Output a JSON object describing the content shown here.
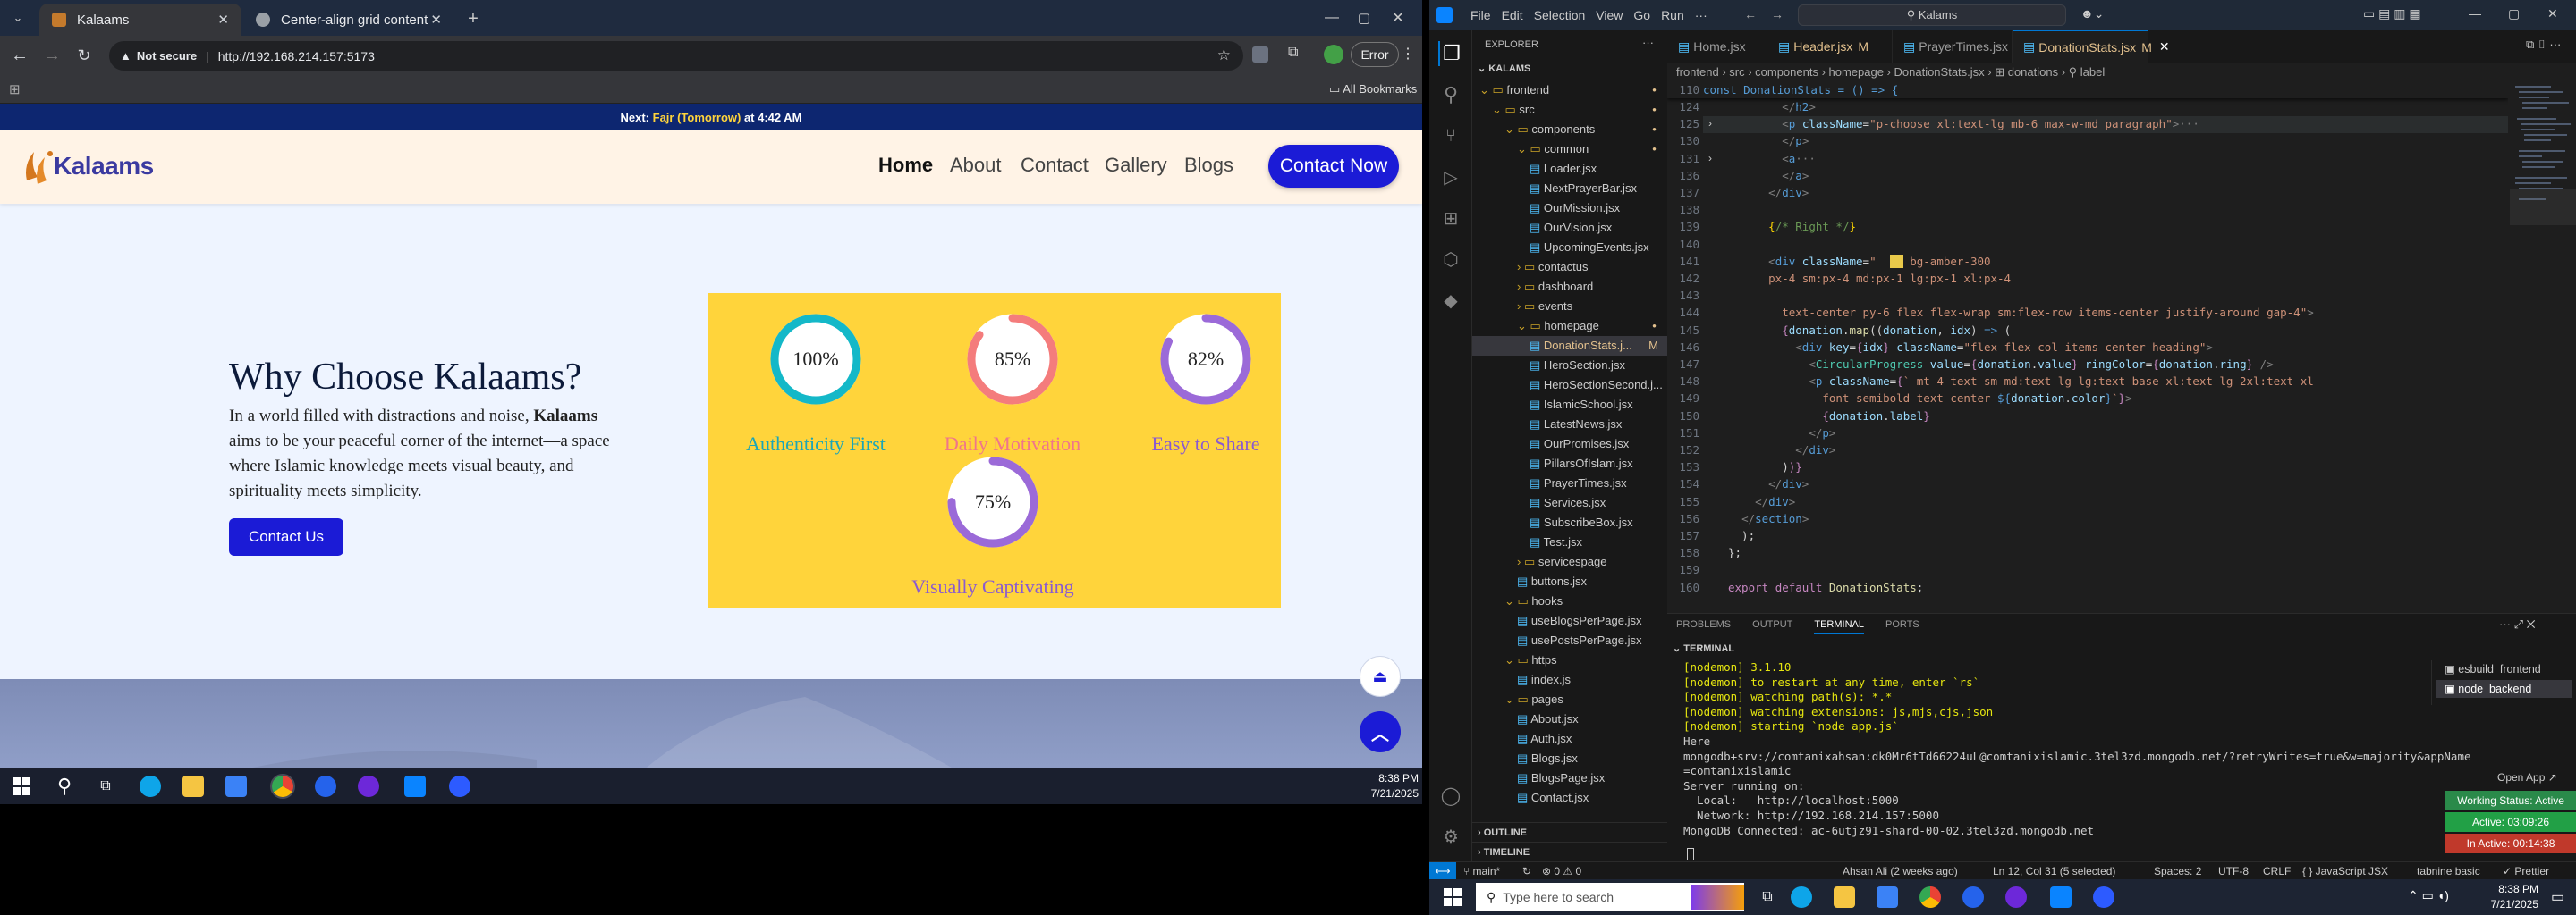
{
  "browser": {
    "tabs": [
      {
        "title": "Kalaams",
        "active": true
      },
      {
        "title": "Center-align grid content",
        "active": false
      }
    ],
    "new_tab": "+",
    "not_secure": "Not secure",
    "url": "http://192.168.214.157:5173",
    "error_label": "Error",
    "bookmarks_label": "All Bookmarks"
  },
  "site": {
    "prayer_prefix": "Next: ",
    "prayer_name": "Fajr (Tomorrow)",
    "prayer_suffix": " at 4:42 AM",
    "logo_text": "Kalaams",
    "nav": [
      "Home",
      "About",
      "Contact",
      "Gallery",
      "Blogs"
    ],
    "contact_now": "Contact Now",
    "why_title": "Why Choose Kalaams?",
    "why_para_1": "In a world filled with distractions and noise, ",
    "why_brand": "Kalaams",
    "why_para_2": " aims to be your peaceful corner of the internet—a space where Islamic knowledge meets visual beauty, and spirituality meets simplicity.",
    "contact_us": "Contact Us",
    "stats": [
      {
        "value": 100,
        "label": "Authenticity First",
        "color": "#14b8c8",
        "text_color": "#1aa5b8"
      },
      {
        "value": 85,
        "label": "Daily Motivation",
        "color": "#f47c7c",
        "text_color": "#f0758b"
      },
      {
        "value": 82,
        "label": "Easy to Share",
        "color": "#9b6ad8",
        "text_color": "#8a5ad0"
      },
      {
        "value": 75,
        "label": "Visually Captivating",
        "color": "#9b6ad8",
        "text_color": "#8a5ad0"
      }
    ],
    "stat_suffix": "%"
  },
  "taskbar_left": {
    "time": "8:38 PM",
    "date": "7/21/2025"
  },
  "vscode": {
    "menu": [
      "File",
      "Edit",
      "Selection",
      "View",
      "Go",
      "Run",
      "···"
    ],
    "search": "Kalams",
    "explorer_title": "EXPLORER",
    "root": "KALAMS",
    "tree": [
      {
        "label": "frontend",
        "depth": 0,
        "kind": "folder-open",
        "dot": true
      },
      {
        "label": "src",
        "depth": 1,
        "kind": "folder-open",
        "dot": true
      },
      {
        "label": "components",
        "depth": 2,
        "kind": "folder-open",
        "dot": true
      },
      {
        "label": "common",
        "depth": 3,
        "kind": "folder-open",
        "dot": true
      },
      {
        "label": "Loader.jsx",
        "depth": 4,
        "kind": "file"
      },
      {
        "label": "NextPrayerBar.jsx",
        "depth": 4,
        "kind": "file"
      },
      {
        "label": "OurMission.jsx",
        "depth": 4,
        "kind": "file"
      },
      {
        "label": "OurVision.jsx",
        "depth": 4,
        "kind": "file"
      },
      {
        "label": "UpcomingEvents.jsx",
        "depth": 4,
        "kind": "file"
      },
      {
        "label": "contactus",
        "depth": 3,
        "kind": "folder"
      },
      {
        "label": "dashboard",
        "depth": 3,
        "kind": "folder"
      },
      {
        "label": "events",
        "depth": 3,
        "kind": "folder"
      },
      {
        "label": "homepage",
        "depth": 3,
        "kind": "folder-open",
        "dot": true
      },
      {
        "label": "DonationStats.j...",
        "depth": 4,
        "kind": "file",
        "selected": true,
        "badge": "M"
      },
      {
        "label": "HeroSection.jsx",
        "depth": 4,
        "kind": "file"
      },
      {
        "label": "HeroSectionSecond.j...",
        "depth": 4,
        "kind": "file"
      },
      {
        "label": "IslamicSchool.jsx",
        "depth": 4,
        "kind": "file"
      },
      {
        "label": "LatestNews.jsx",
        "depth": 4,
        "kind": "file"
      },
      {
        "label": "OurPromises.jsx",
        "depth": 4,
        "kind": "file"
      },
      {
        "label": "PillarsOfIslam.jsx",
        "depth": 4,
        "kind": "file"
      },
      {
        "label": "PrayerTimes.jsx",
        "depth": 4,
        "kind": "file"
      },
      {
        "label": "Services.jsx",
        "depth": 4,
        "kind": "file"
      },
      {
        "label": "SubscribeBox.jsx",
        "depth": 4,
        "kind": "file"
      },
      {
        "label": "Test.jsx",
        "depth": 4,
        "kind": "file"
      },
      {
        "label": "servicespage",
        "depth": 3,
        "kind": "folder"
      },
      {
        "label": "buttons.jsx",
        "depth": 3,
        "kind": "file"
      },
      {
        "label": "hooks",
        "depth": 2,
        "kind": "folder-open"
      },
      {
        "label": "useBlogsPerPage.jsx",
        "depth": 3,
        "kind": "file"
      },
      {
        "label": "usePostsPerPage.jsx",
        "depth": 3,
        "kind": "file"
      },
      {
        "label": "https",
        "depth": 2,
        "kind": "folder-open"
      },
      {
        "label": "index.js",
        "depth": 3,
        "kind": "file"
      },
      {
        "label": "pages",
        "depth": 2,
        "kind": "folder-open"
      },
      {
        "label": "About.jsx",
        "depth": 3,
        "kind": "file"
      },
      {
        "label": "Auth.jsx",
        "depth": 3,
        "kind": "file"
      },
      {
        "label": "Blogs.jsx",
        "depth": 3,
        "kind": "file"
      },
      {
        "label": "BlogsPage.jsx",
        "depth": 3,
        "kind": "file"
      },
      {
        "label": "Contact.jsx",
        "depth": 3,
        "kind": "file"
      }
    ],
    "outline": "OUTLINE",
    "timeline": "TIMELINE",
    "editor_tabs": [
      {
        "label": "Home.jsx",
        "badge": ""
      },
      {
        "label": "Header.jsx",
        "badge": "M"
      },
      {
        "label": "PrayerTimes.jsx",
        "badge": ""
      },
      {
        "label": "DonationStats.jsx",
        "badge": "M",
        "active": true
      }
    ],
    "breadcrumb": "frontend › src › components › homepage › DonationStats.jsx › ⊞ donations › ⚲ label",
    "sticky_line_no": "110",
    "sticky_line": "const DonationStats = () => {",
    "line_numbers": [
      "124",
      "125",
      "130",
      "131",
      "136",
      "137",
      "138",
      "139",
      "140",
      "141",
      "142",
      "143",
      "144",
      "145",
      "146",
      "147",
      "148",
      "149",
      "150",
      "151",
      "152",
      "153",
      "154",
      "155",
      "156",
      "157",
      "158",
      "159",
      "160"
    ],
    "panel_tabs": [
      "PROBLEMS",
      "OUTPUT",
      "TERMINAL",
      "PORTS"
    ],
    "terminal_header": "TERMINAL",
    "terminal_lines": [
      {
        "text": "[nodemon] 3.1.10",
        "yellow": true
      },
      {
        "text": "[nodemon] to restart at any time, enter `rs`",
        "yellow": true
      },
      {
        "text": "[nodemon] watching path(s): *.*",
        "yellow": true
      },
      {
        "text": "[nodemon] watching extensions: js,mjs,cjs,json",
        "yellow": true
      },
      {
        "text": "[nodemon] starting `node app.js`",
        "yellow": true
      },
      {
        "text": "Here",
        "yellow": false
      },
      {
        "text": "mongodb+srv://comtanixahsan:dk0Mr6tTd66224uL@comtanixislamic.3tel3zd.mongodb.net/?retryWrites=true&w=majority&appName",
        "yellow": false
      },
      {
        "text": "=comtanixislamic",
        "yellow": false
      },
      {
        "text": "Server running on:",
        "yellow": false
      },
      {
        "text": "  Local:   http://localhost:5000",
        "yellow": false
      },
      {
        "text": "  Network: http://192.168.214.157:5000",
        "yellow": false
      },
      {
        "text": "MongoDB Connected: ac-6utjz91-shard-00-02.3tel3zd.mongodb.net",
        "yellow": false
      }
    ],
    "term_procs": [
      "esbuild  frontend",
      "node  backend"
    ],
    "open_app": "Open App ↗",
    "working_status": "Working Status: Active",
    "active_time": "Active: 03:09:26",
    "inactive_time": "In Active: 00:14:38",
    "status": {
      "branch": "main*",
      "errors": "⊗ 0 ⚠ 0",
      "blame": "Ahsan Ali (2 weeks ago)",
      "position": "Ln 12, Col 31 (5 selected)",
      "spaces": "Spaces: 2",
      "encoding": "UTF-8",
      "eol": "CRLF",
      "language": "{ } JavaScript JSX",
      "tabnine": "tabnine basic",
      "prettier": "✓ Prettier"
    }
  },
  "taskbar_right": {
    "search_placeholder": "Type here to search",
    "time": "8:38 PM",
    "date": "7/21/2025"
  }
}
